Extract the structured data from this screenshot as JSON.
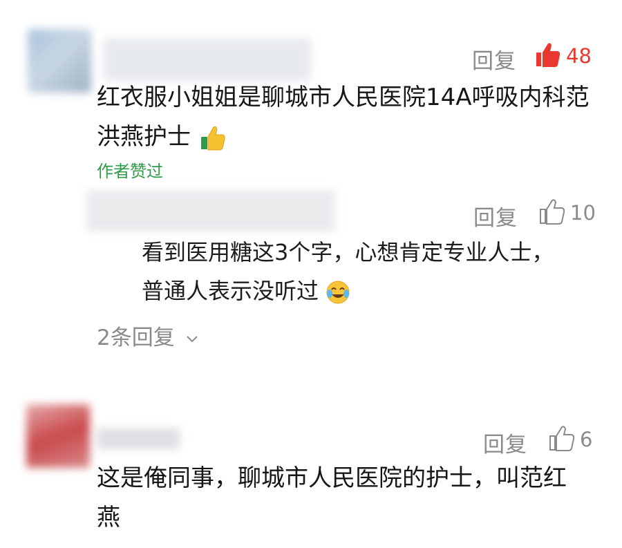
{
  "comments": [
    {
      "reply_label": "回复",
      "like_count": "48",
      "liked": true,
      "text_line1": "红衣服小姐姐是聊城市人民医院14A呼吸内科范",
      "text_line2": "洪燕护士",
      "emoji": "thumbs-up",
      "author_liked": "作者赞过",
      "replies": [
        {
          "reply_label": "回复",
          "like_count": "10",
          "text_line1": "看到医用糖这3个字，心想肯定专业人士，",
          "text_line2": "普通人表示没听过",
          "emoji": "crying-laughing-face"
        }
      ],
      "expand_label": "2条回复"
    },
    {
      "reply_label": "回复",
      "like_count": "6",
      "liked": false,
      "text_line1": "这是俺同事，聊城市人民医院的护士，叫范红",
      "text_line2": "燕"
    }
  ],
  "colors": {
    "accent_red": "#e8382f",
    "author_green": "#2f9a4a",
    "muted": "#8a8a8a"
  },
  "icons": {
    "like_filled": "thumbs-up-filled-icon",
    "like_outline": "thumbs-up-outline-icon",
    "expand": "chevron-down-icon"
  }
}
